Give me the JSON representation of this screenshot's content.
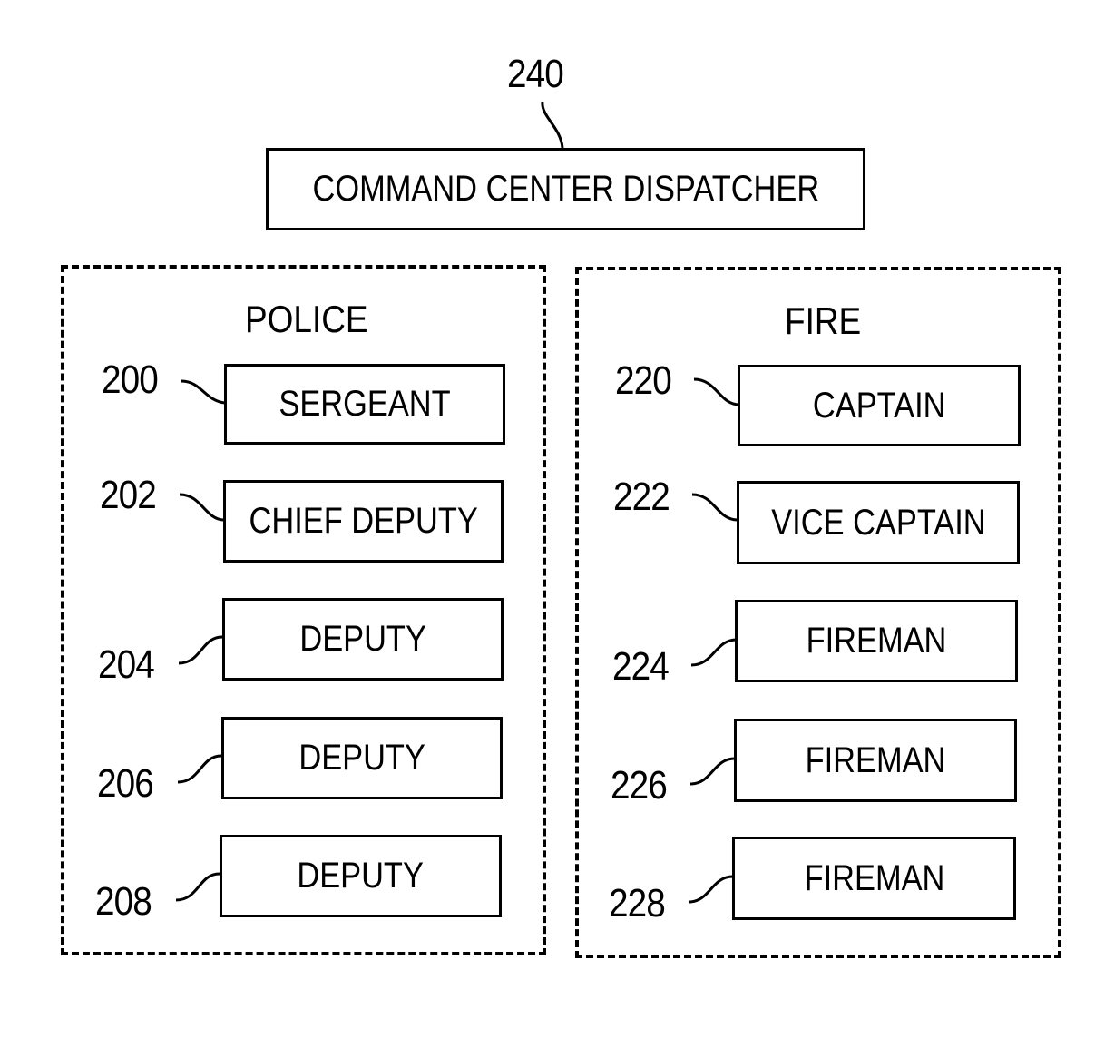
{
  "diagram": {
    "dispatcher": {
      "ref": "240",
      "label": "COMMAND CENTER DISPATCHER"
    },
    "groups": [
      {
        "title": "POLICE",
        "members": [
          {
            "ref": "200",
            "label": "SERGEANT"
          },
          {
            "ref": "202",
            "label": "CHIEF DEPUTY"
          },
          {
            "ref": "204",
            "label": "DEPUTY"
          },
          {
            "ref": "206",
            "label": "DEPUTY"
          },
          {
            "ref": "208",
            "label": "DEPUTY"
          }
        ]
      },
      {
        "title": "FIRE",
        "members": [
          {
            "ref": "220",
            "label": "CAPTAIN"
          },
          {
            "ref": "222",
            "label": "VICE CAPTAIN"
          },
          {
            "ref": "224",
            "label": "FIREMAN"
          },
          {
            "ref": "226",
            "label": "FIREMAN"
          },
          {
            "ref": "228",
            "label": "FIREMAN"
          }
        ]
      }
    ]
  }
}
